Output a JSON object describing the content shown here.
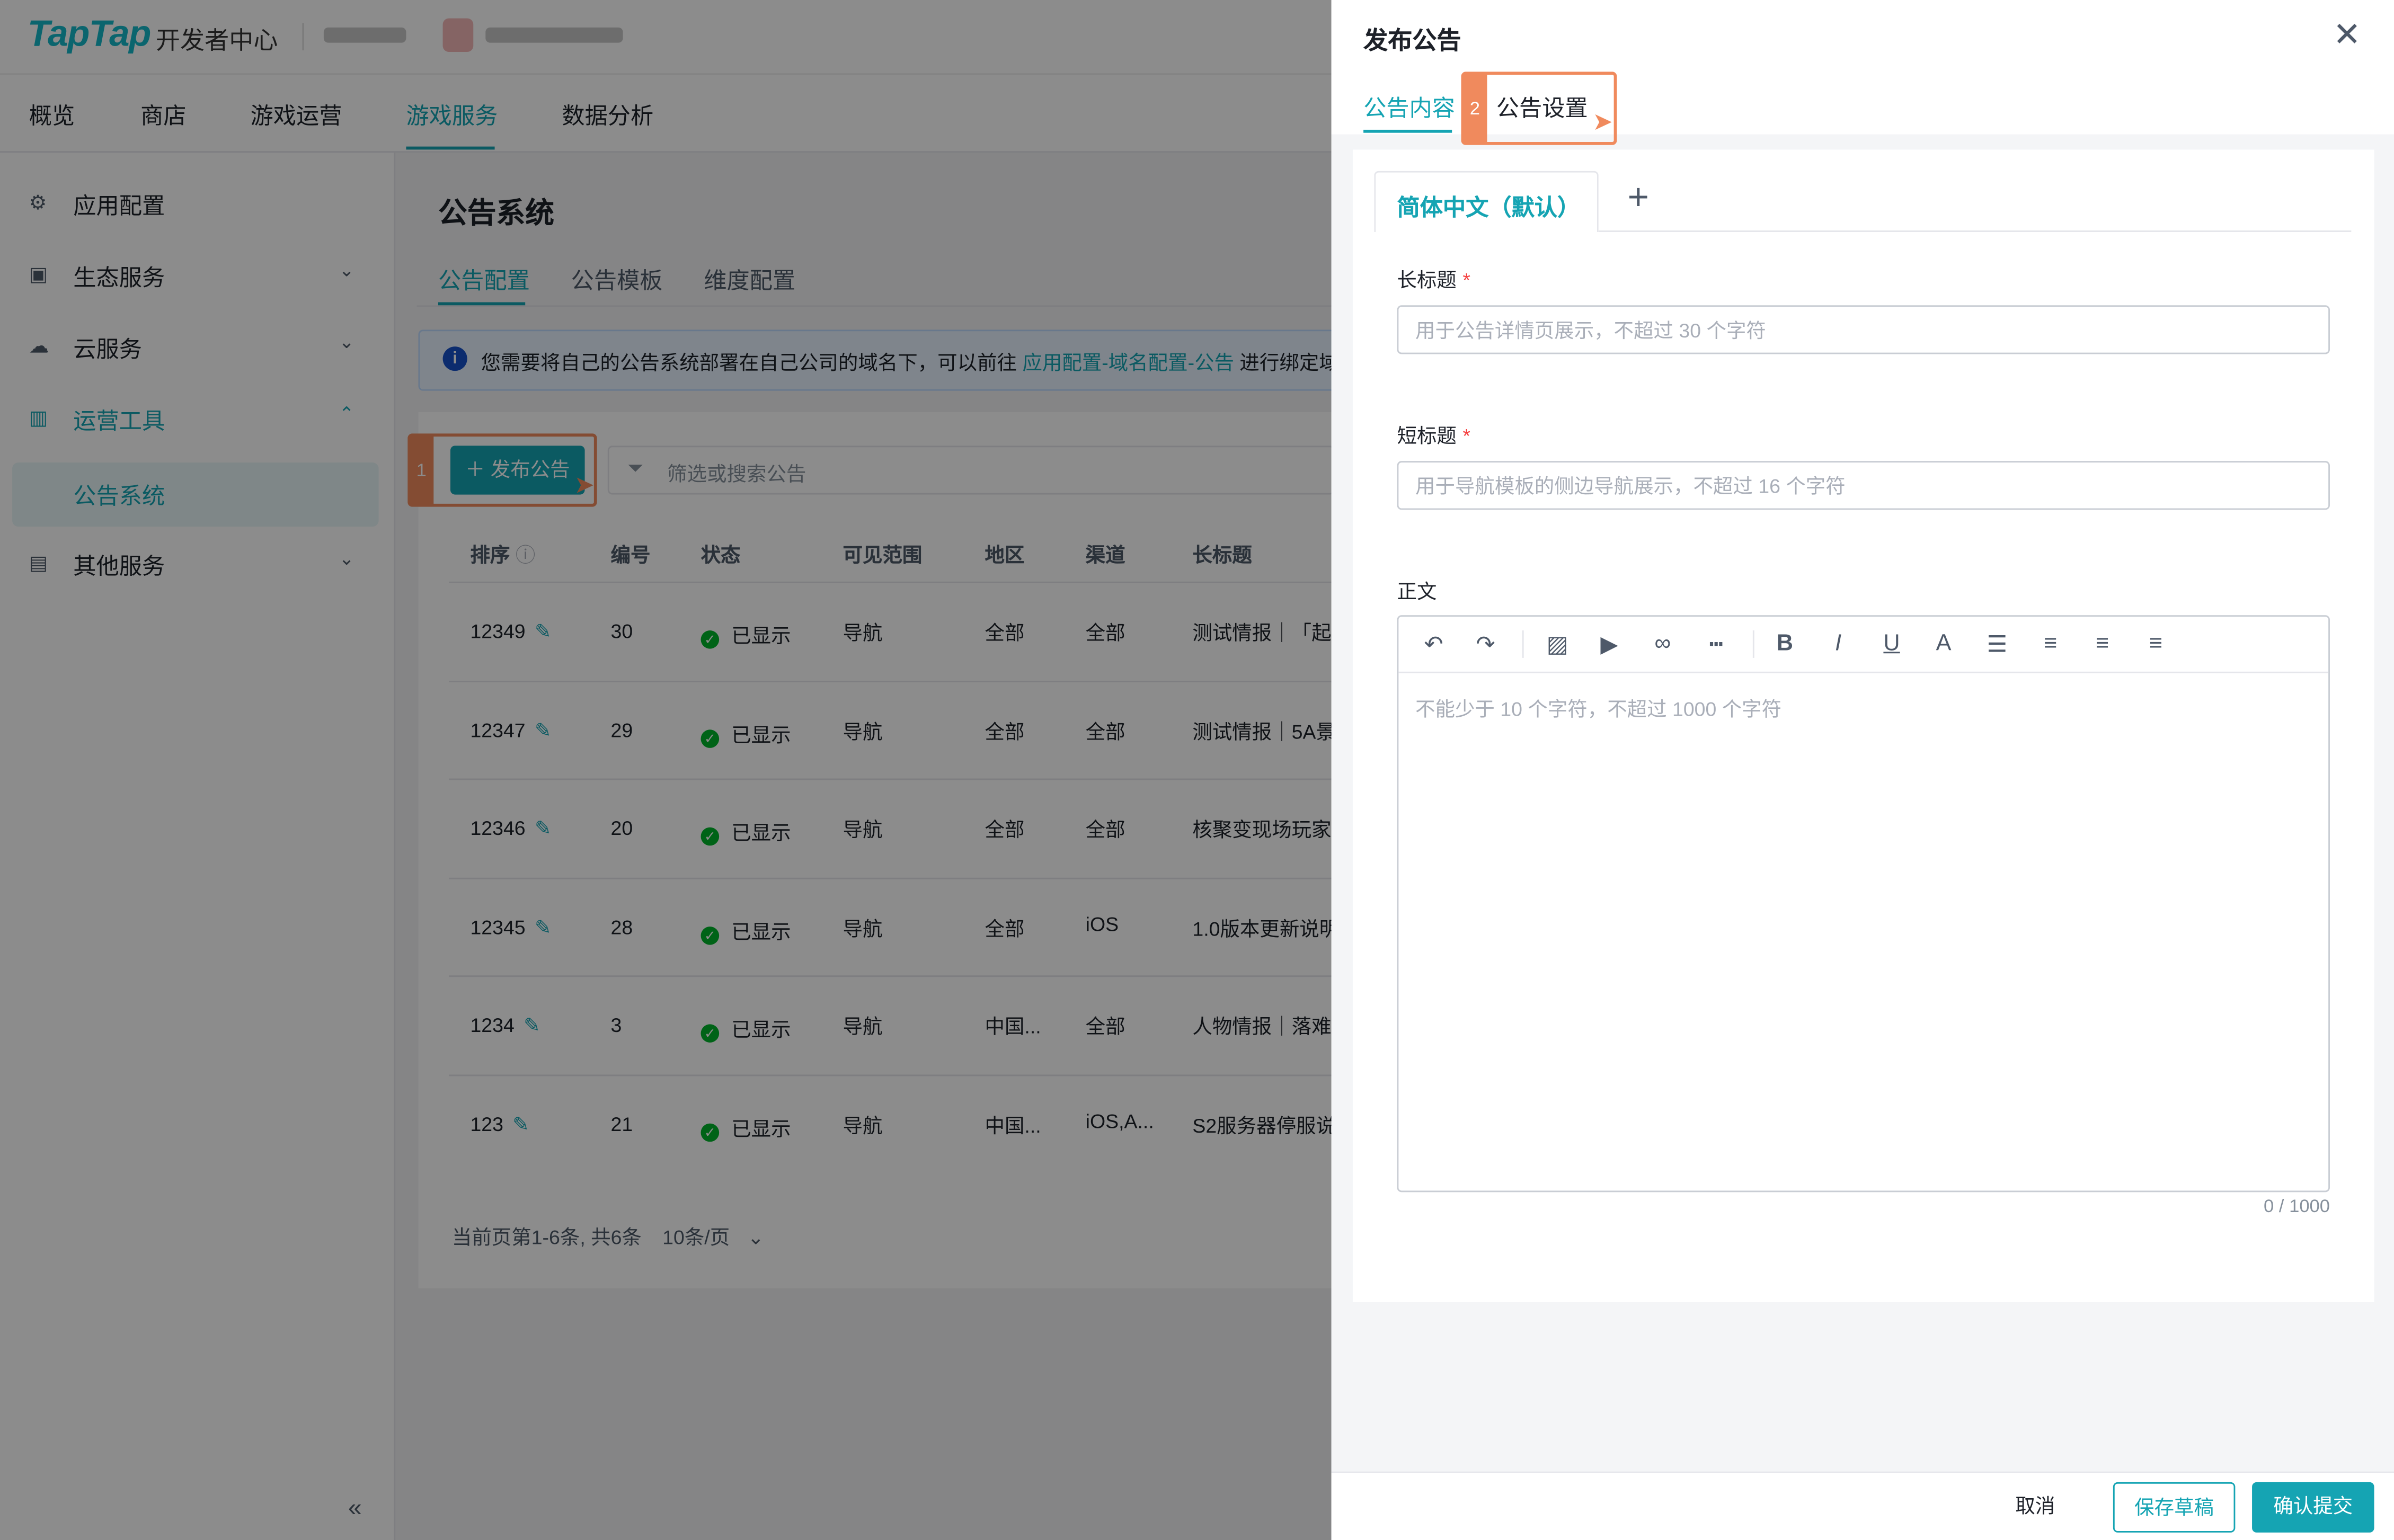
{
  "app": {
    "logo": "TapTap",
    "logo_sub": "开发者中心"
  },
  "topnav": [
    "概览",
    "商店",
    "游戏运营",
    "游戏服务",
    "数据分析"
  ],
  "topnav_active": "游戏服务",
  "sidebar": {
    "items": [
      {
        "label": "应用配置",
        "icon": "gear-icon"
      },
      {
        "label": "生态服务",
        "icon": "terminal-icon"
      },
      {
        "label": "云服务",
        "icon": "cloud-icon"
      },
      {
        "label": "运营工具",
        "icon": "chart-icon"
      },
      {
        "label": "其他服务",
        "icon": "card-icon"
      }
    ],
    "sub_item": "公告系统"
  },
  "content": {
    "title": "公告系统",
    "tabs": [
      "公告配置",
      "公告模板",
      "维度配置"
    ],
    "info_text": "您需要将自己的公告系统部署在自己公司的域名下，可以前往 ",
    "info_link": "应用配置-域名配置-公告",
    "info_tail": " 进行绑定域",
    "publish_button": "发布公告",
    "search_placeholder": "筛选或搜索公告",
    "step1": "1",
    "columns": [
      "排序",
      "编号",
      "状态",
      "可见范围",
      "地区",
      "渠道",
      "长标题"
    ],
    "rows": [
      {
        "sort": "12349",
        "id": "30",
        "status": "已显示",
        "scope": "导航",
        "region": "全部",
        "channel": "全部",
        "title": "测试情报｜「起"
      },
      {
        "sort": "12347",
        "id": "29",
        "status": "已显示",
        "scope": "导航",
        "region": "全部",
        "channel": "全部",
        "title": "测试情报｜5A景"
      },
      {
        "sort": "12346",
        "id": "20",
        "status": "已显示",
        "scope": "导航",
        "region": "全部",
        "channel": "全部",
        "title": "核聚变现场玩家"
      },
      {
        "sort": "12345",
        "id": "28",
        "status": "已显示",
        "scope": "导航",
        "region": "全部",
        "channel": "iOS",
        "title": "1.0版本更新说明"
      },
      {
        "sort": "1234",
        "id": "3",
        "status": "已显示",
        "scope": "导航",
        "region": "中国...",
        "channel": "全部",
        "title": "人物情报｜落难"
      },
      {
        "sort": "123",
        "id": "21",
        "status": "已显示",
        "scope": "导航",
        "region": "中国...",
        "channel": "iOS,A...",
        "title": "S2服务器停服说"
      }
    ],
    "pager": "当前页第1-6条, 共6条",
    "page_size": "10条/页"
  },
  "drawer": {
    "title": "发布公告",
    "tabs": [
      "公告内容",
      "公告设置"
    ],
    "step2": "2",
    "lang_tab": "简体中文（默认）",
    "long_title_label": "长标题",
    "long_title_placeholder": "用于公告详情页展示，不超过 30 个字符",
    "short_title_label": "短标题",
    "short_title_placeholder": "用于导航模板的侧边导航展示，不超过 16 个字符",
    "body_label": "正文",
    "body_placeholder": "不能少于 10 个字符，不超过 1000 个字符",
    "counter": "0 / 1000",
    "cancel": "取消",
    "save_draft": "保存草稿",
    "submit": "确认提交"
  },
  "colors": {
    "accent": "#15a4b3",
    "highlight": "#f08a5d",
    "required": "#f53f3f"
  }
}
